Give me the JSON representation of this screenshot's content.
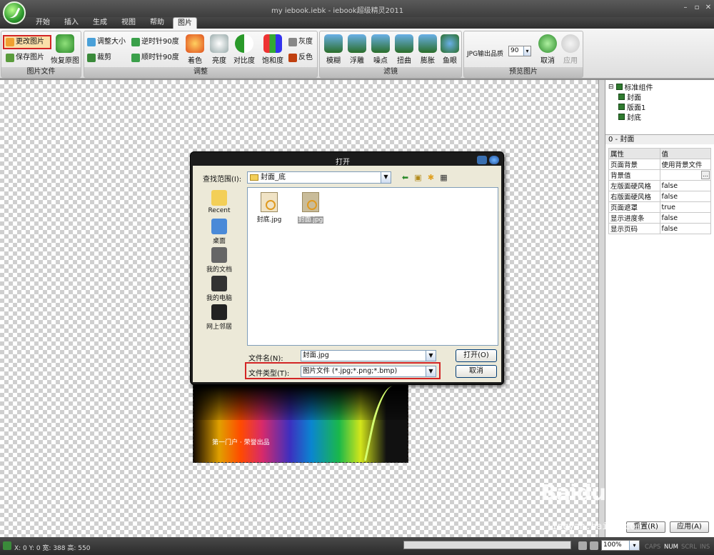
{
  "window": {
    "title": "my iebook.iebk - iebook超级精灵2011"
  },
  "menu": {
    "items": [
      "开始",
      "插入",
      "生成",
      "视图",
      "帮助",
      "图片"
    ],
    "active": "图片"
  },
  "ribbon": {
    "groups": {
      "file": "图片文件",
      "adjust": "调整",
      "filter": "滤镜",
      "preview": "预览图片"
    },
    "file": {
      "change": "更改图片",
      "save": "保存图片",
      "restore": "恢复原图"
    },
    "adjust": {
      "resize": "调整大小",
      "crop": "裁剪",
      "rotate_ccw": "逆时针90度",
      "rotate_cw": "顺时针90度",
      "tint": "着色",
      "brightness": "亮度",
      "contrast": "对比度",
      "saturation": "饱和度",
      "gray": "灰度",
      "invert": "反色"
    },
    "filter": {
      "blur": "模糊",
      "emboss": "浮雕",
      "sharpen": "噪点",
      "twist": "扭曲",
      "bulge": "膨胀",
      "fisheye": "鱼眼"
    },
    "preview": {
      "quality_label": "JPG输出品质",
      "quality_value": "90",
      "cancel": "取消",
      "apply": "应用"
    }
  },
  "tree": {
    "root": "标准组件",
    "items": [
      "封面",
      "版面1",
      "封底"
    ]
  },
  "properties": {
    "header": "0 - 封面",
    "columns": [
      "属性",
      "值"
    ],
    "rows": [
      [
        "页面背景",
        "使用背景文件"
      ],
      [
        "背景值",
        ""
      ],
      [
        "左版面硬风格",
        "false"
      ],
      [
        "右版面硬风格",
        "false"
      ],
      [
        "页面遮罩",
        "true"
      ],
      [
        "显示进度条",
        "false"
      ],
      [
        "显示页码",
        "false"
      ]
    ],
    "reset": "重置(R)",
    "apply": "应用(A)"
  },
  "dialog": {
    "title": "打开",
    "look_in_label": "查找范围(I):",
    "look_in_value": "封面_底",
    "places": [
      "Recent",
      "桌面",
      "我的文档",
      "我的电脑",
      "网上邻居"
    ],
    "files": [
      "封底.jpg",
      "封面.jpg"
    ],
    "filename_label": "文件名(N):",
    "filename_value": "封面.jpg",
    "filetype_label": "文件类型(T):",
    "filetype_value": "图片文件 (*.jpg;*.png;*.bmp)",
    "open_button": "打开(O)",
    "cancel_button": "取消"
  },
  "canvas": {
    "caption": "第一门户 · 荣誉出品"
  },
  "status": {
    "text": "X: 0  Y: 0  宽: 388  高: 550",
    "zoom": "100%",
    "keys": [
      "CAPS",
      "NUM",
      "SCRL",
      "INS"
    ]
  },
  "watermark": {
    "brand": "Baidu经验",
    "url": "jingyan.baidu.com"
  },
  "colors": {
    "highlight": "#d32525",
    "ribbon_bg": "#e6e6e6",
    "titlebar": "#3e3e3e"
  }
}
